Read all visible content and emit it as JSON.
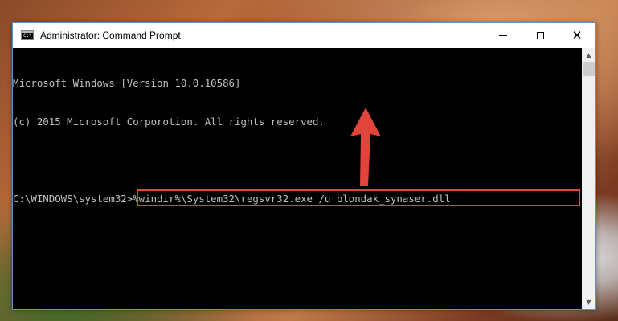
{
  "window": {
    "title": "Administrator: Command Prompt",
    "icon": "cmd-icon",
    "icon_text": "C:\\"
  },
  "controls": {
    "minimize_icon": "minimize-icon",
    "maximize_icon": "maximize-icon",
    "close_icon": "close-icon",
    "close_glyph": "✕"
  },
  "console": {
    "lines": [
      "Microsoft Windows [Version 10.0.10586]",
      "(c) 2015 Microsoft Corporotion. All rights reserved."
    ],
    "prompt": "C:\\WINDOWS\\system32>",
    "command": "%windir%\\System32\\regsvr32.exe /u blondak_synaser.dll"
  },
  "scrollbar": {
    "up_glyph": "▲",
    "down_glyph": "▼"
  },
  "annotation": {
    "highlight_color": "#e0443a",
    "arrow_color": "#e0443a"
  }
}
